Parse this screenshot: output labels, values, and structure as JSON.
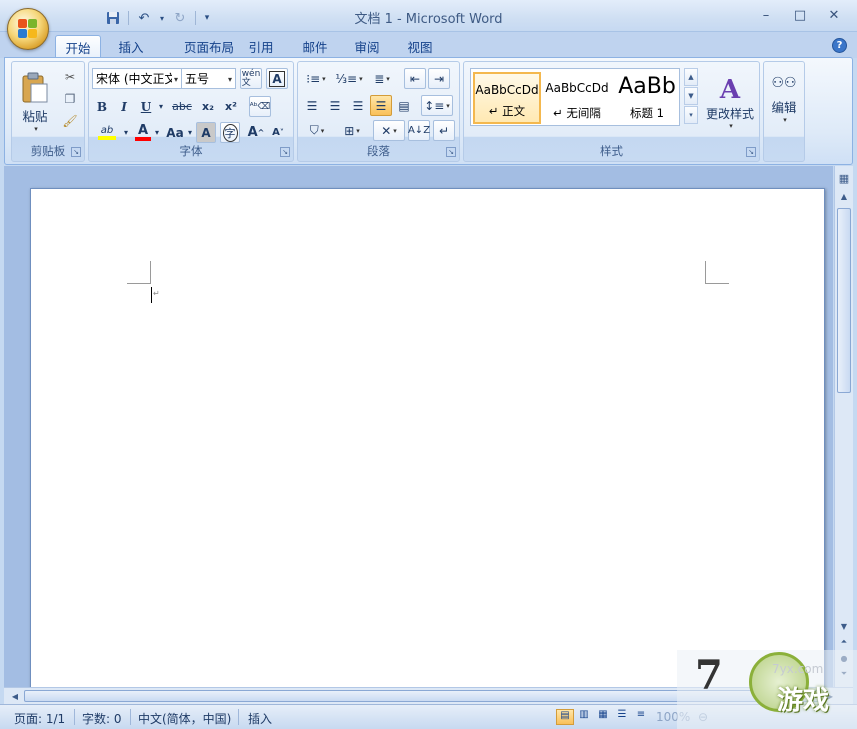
{
  "window": {
    "title": "文档 1 - Microsoft Word",
    "controls": {
      "minimize": "–",
      "maximize": "□",
      "close": "✕"
    }
  },
  "qat": {
    "save_icon": "save-icon",
    "undo_icon": "undo-icon",
    "redo_icon": "redo-icon",
    "customize_icon": "customize-qat-icon"
  },
  "tabs": [
    {
      "label": "开始",
      "active": true
    },
    {
      "label": "插入"
    },
    {
      "label": "页面布局"
    },
    {
      "label": "引用"
    },
    {
      "label": "邮件"
    },
    {
      "label": "审阅"
    },
    {
      "label": "视图"
    }
  ],
  "ribbon": {
    "clipboard": {
      "label": "剪贴板",
      "paste_label": "粘贴"
    },
    "font": {
      "label": "字体",
      "font_name": "宋体 (中文正文",
      "font_size": "五号",
      "grow_font": "A",
      "shrink_font": "A",
      "change_case": "Aa",
      "bold": "B",
      "italic": "I",
      "underline": "U",
      "strike": "abc",
      "subscript": "x₂",
      "superscript": "x²",
      "phonetic": "wén 文",
      "char_border": "A",
      "char_shading": "A",
      "enclose": "字",
      "highlight": "ab",
      "font_color": "A"
    },
    "paragraph": {
      "label": "段落"
    },
    "styles": {
      "label": "样式",
      "items": [
        {
          "sample": "AaBbCcDd",
          "name": "↵ 正文",
          "selected": true
        },
        {
          "sample": "AaBbCcDd",
          "name": "↵ 无间隔"
        },
        {
          "sample": "AaBb",
          "name": "标题 1"
        }
      ],
      "change_styles": "更改样式"
    },
    "editing": {
      "label": "编辑"
    }
  },
  "statusbar": {
    "page": "页面: 1/1",
    "words": "字数: 0",
    "language": "中文(简体，中国)",
    "mode": "插入",
    "zoom": "100%"
  },
  "watermark": {
    "brand": "游戏",
    "digit": "7",
    "url": "7yx.com"
  },
  "colors": {
    "highlight_yellow": "#ffff00",
    "font_red": "#ff0000",
    "selected_style_border": "#f4b84e"
  }
}
